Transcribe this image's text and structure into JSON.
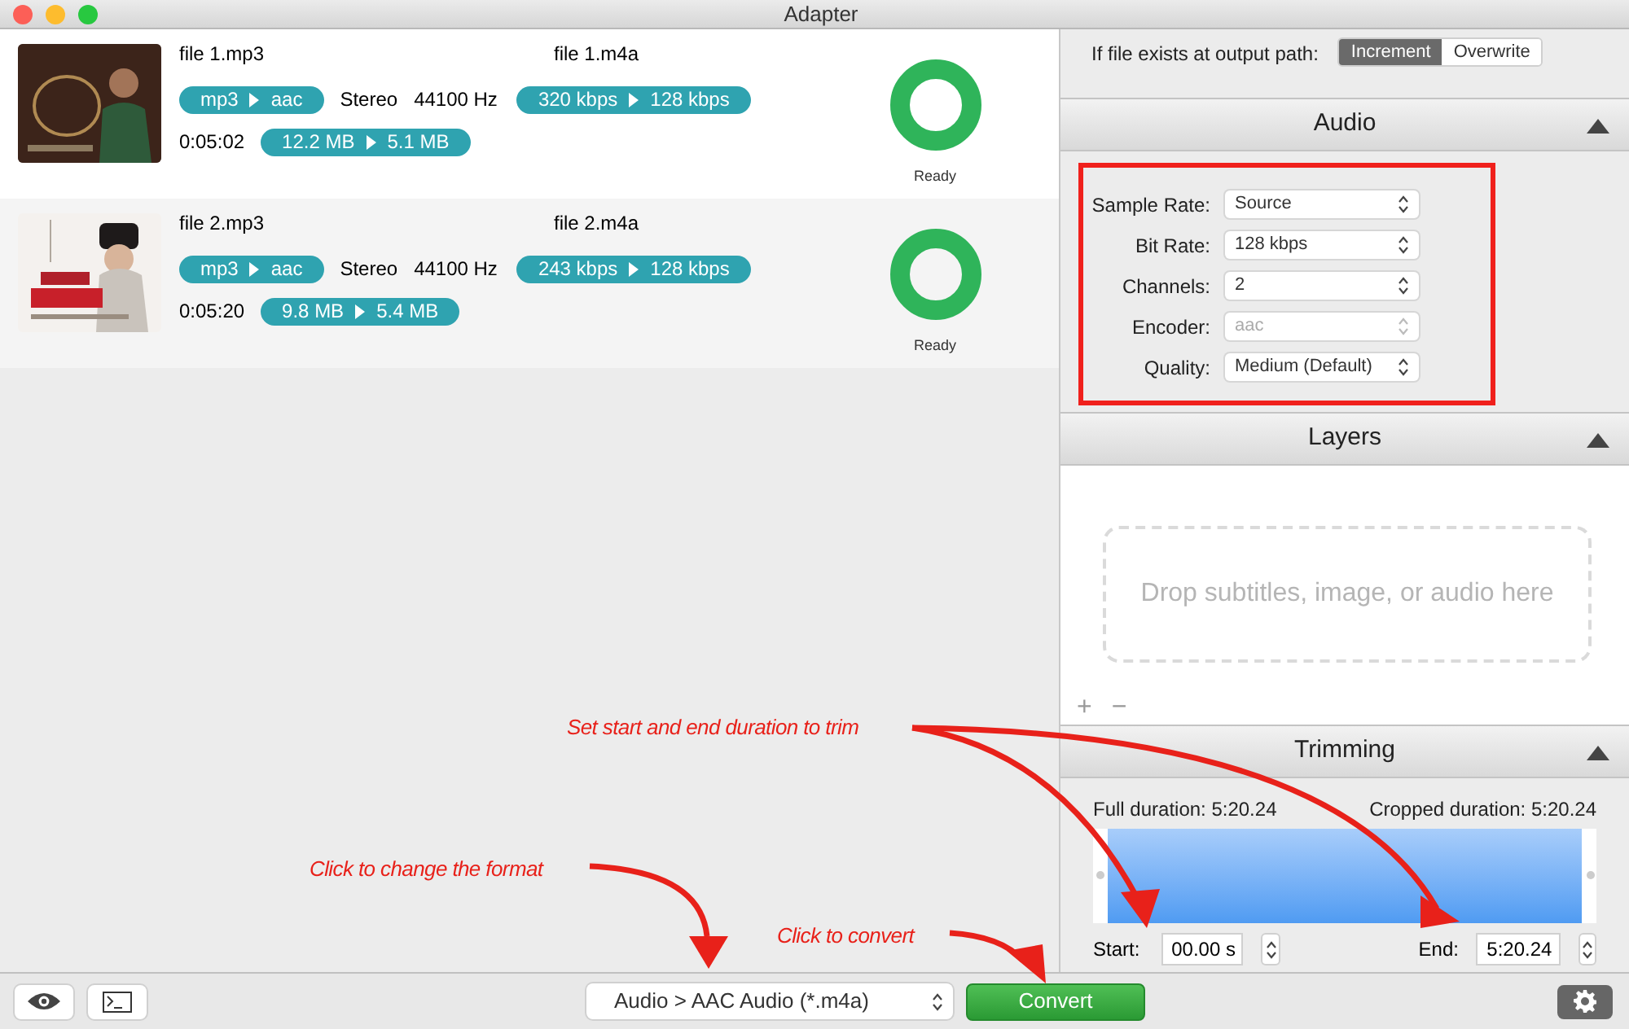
{
  "window": {
    "title": "Adapter"
  },
  "files": [
    {
      "source_name": "file 1.mp3",
      "output_name": "file 1.m4a",
      "format_from": "mp3",
      "format_to": "aac",
      "channels": "Stereo",
      "sample_rate": "44100 Hz",
      "bitrate_from": "320 kbps",
      "bitrate_to": "128 kbps",
      "duration": "0:05:02",
      "size_from": "12.2 MB",
      "size_to": "5.1 MB",
      "status": "Ready"
    },
    {
      "source_name": "file 2.mp3",
      "output_name": "file 2.m4a",
      "format_from": "mp3",
      "format_to": "aac",
      "channels": "Stereo",
      "sample_rate": "44100 Hz",
      "bitrate_from": "243 kbps",
      "bitrate_to": "128 kbps",
      "duration": "0:05:20",
      "size_from": "9.8 MB",
      "size_to": "5.4 MB",
      "status": "Ready"
    }
  ],
  "output_conflict": {
    "label": "If file exists at output path:",
    "options": [
      {
        "label": "Increment",
        "selected": true
      },
      {
        "label": "Overwrite",
        "selected": false
      }
    ]
  },
  "audio": {
    "title": "Audio",
    "expanded": true,
    "highlighted": true,
    "settings": [
      {
        "label": "Sample Rate:",
        "value": "Source",
        "disabled": false
      },
      {
        "label": "Bit Rate:",
        "value": "128 kbps",
        "disabled": false
      },
      {
        "label": "Channels:",
        "value": "2",
        "disabled": false
      },
      {
        "label": "Encoder:",
        "value": "aac",
        "disabled": true
      },
      {
        "label": "Quality:",
        "value": "Medium (Default)",
        "disabled": false
      }
    ]
  },
  "layers": {
    "title": "Layers",
    "expanded": true,
    "drop_hint": "Drop subtitles, image, or audio here",
    "buttons": [
      "+",
      "−"
    ]
  },
  "trimming": {
    "title": "Trimming",
    "expanded": true,
    "full_duration": "Full duration: 5:20.24",
    "cropped_duration": "Cropped duration: 5:20.24",
    "start_label": "Start:",
    "start_value": "00.00 s",
    "end_label": "End:",
    "end_value": "5:20.24"
  },
  "bottom_bar": {
    "format": "Audio > AAC Audio (*.m4a)",
    "convert": "Convert"
  },
  "annotations": [
    {
      "text": "Set start and end duration to trim"
    },
    {
      "text": "Click to change the format"
    },
    {
      "text": "Click to convert"
    }
  ]
}
